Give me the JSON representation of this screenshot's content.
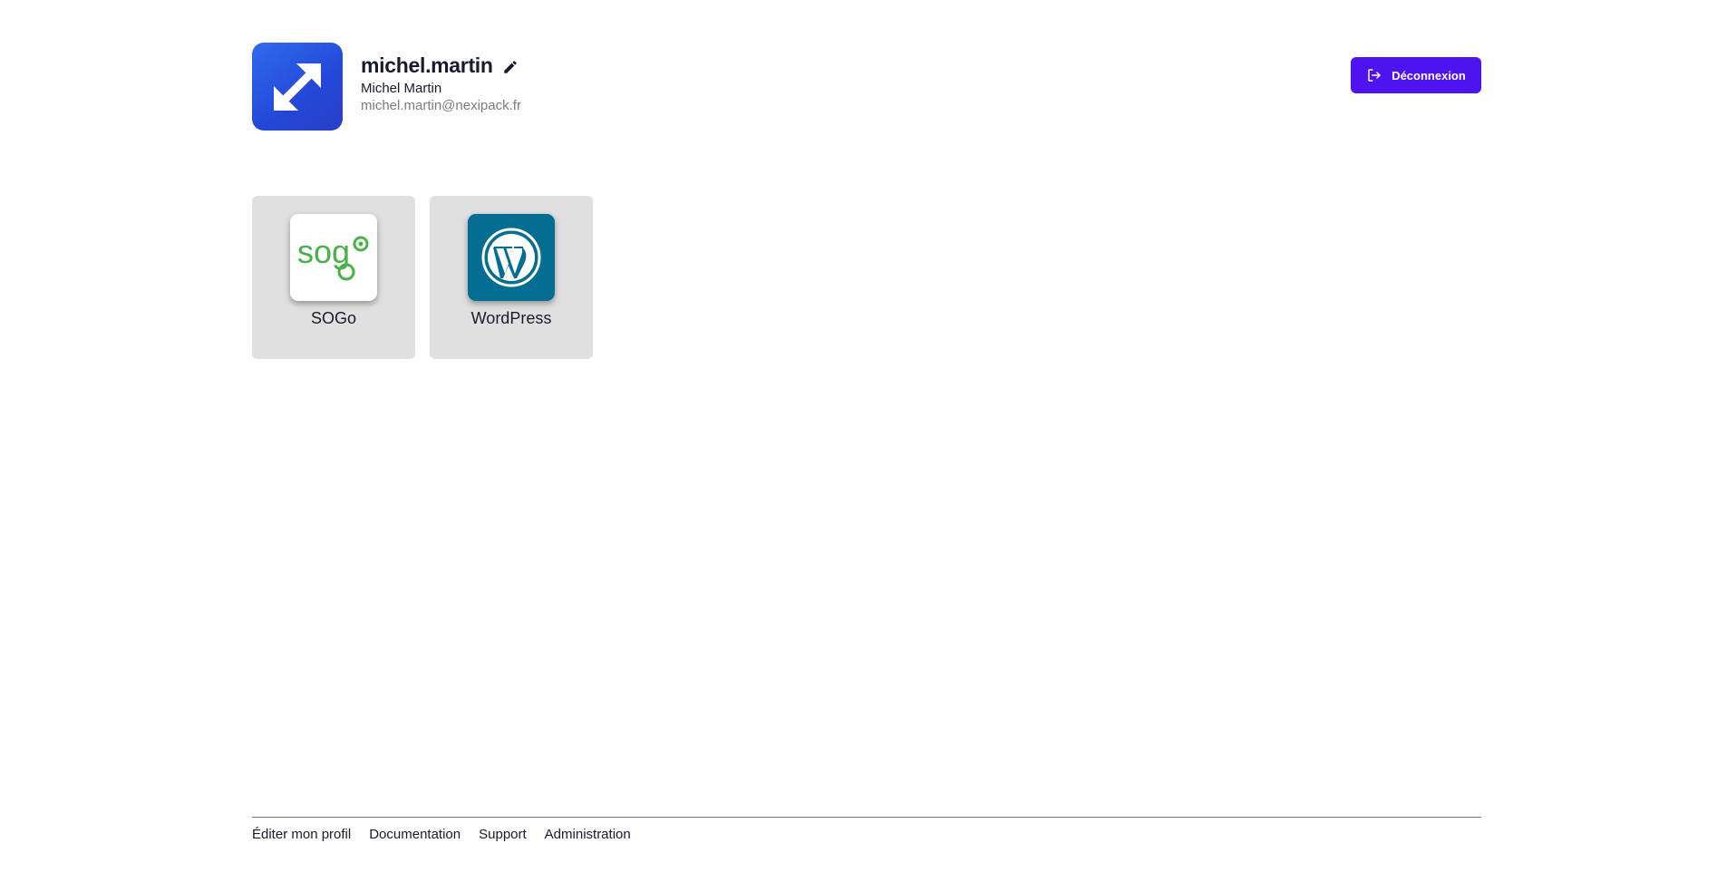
{
  "user": {
    "username": "michel.martin",
    "fullname": "Michel Martin",
    "email": "michel.martin@nexipack.fr"
  },
  "header": {
    "logout_label": "Déconnexion"
  },
  "apps": [
    {
      "label": "SOGo",
      "icon": "sogo-logo-icon"
    },
    {
      "label": "WordPress",
      "icon": "wordpress-logo-icon"
    }
  ],
  "footer": {
    "links": [
      "Éditer mon profil",
      "Documentation",
      "Support",
      "Administration"
    ]
  },
  "colors": {
    "accent": "#4f13f2",
    "avatar": "#2447d8",
    "tile": "#e0e0e0",
    "wordpress": "#046e92",
    "sogo_green": "#49b14a"
  },
  "sogo_logo_text": "sog"
}
